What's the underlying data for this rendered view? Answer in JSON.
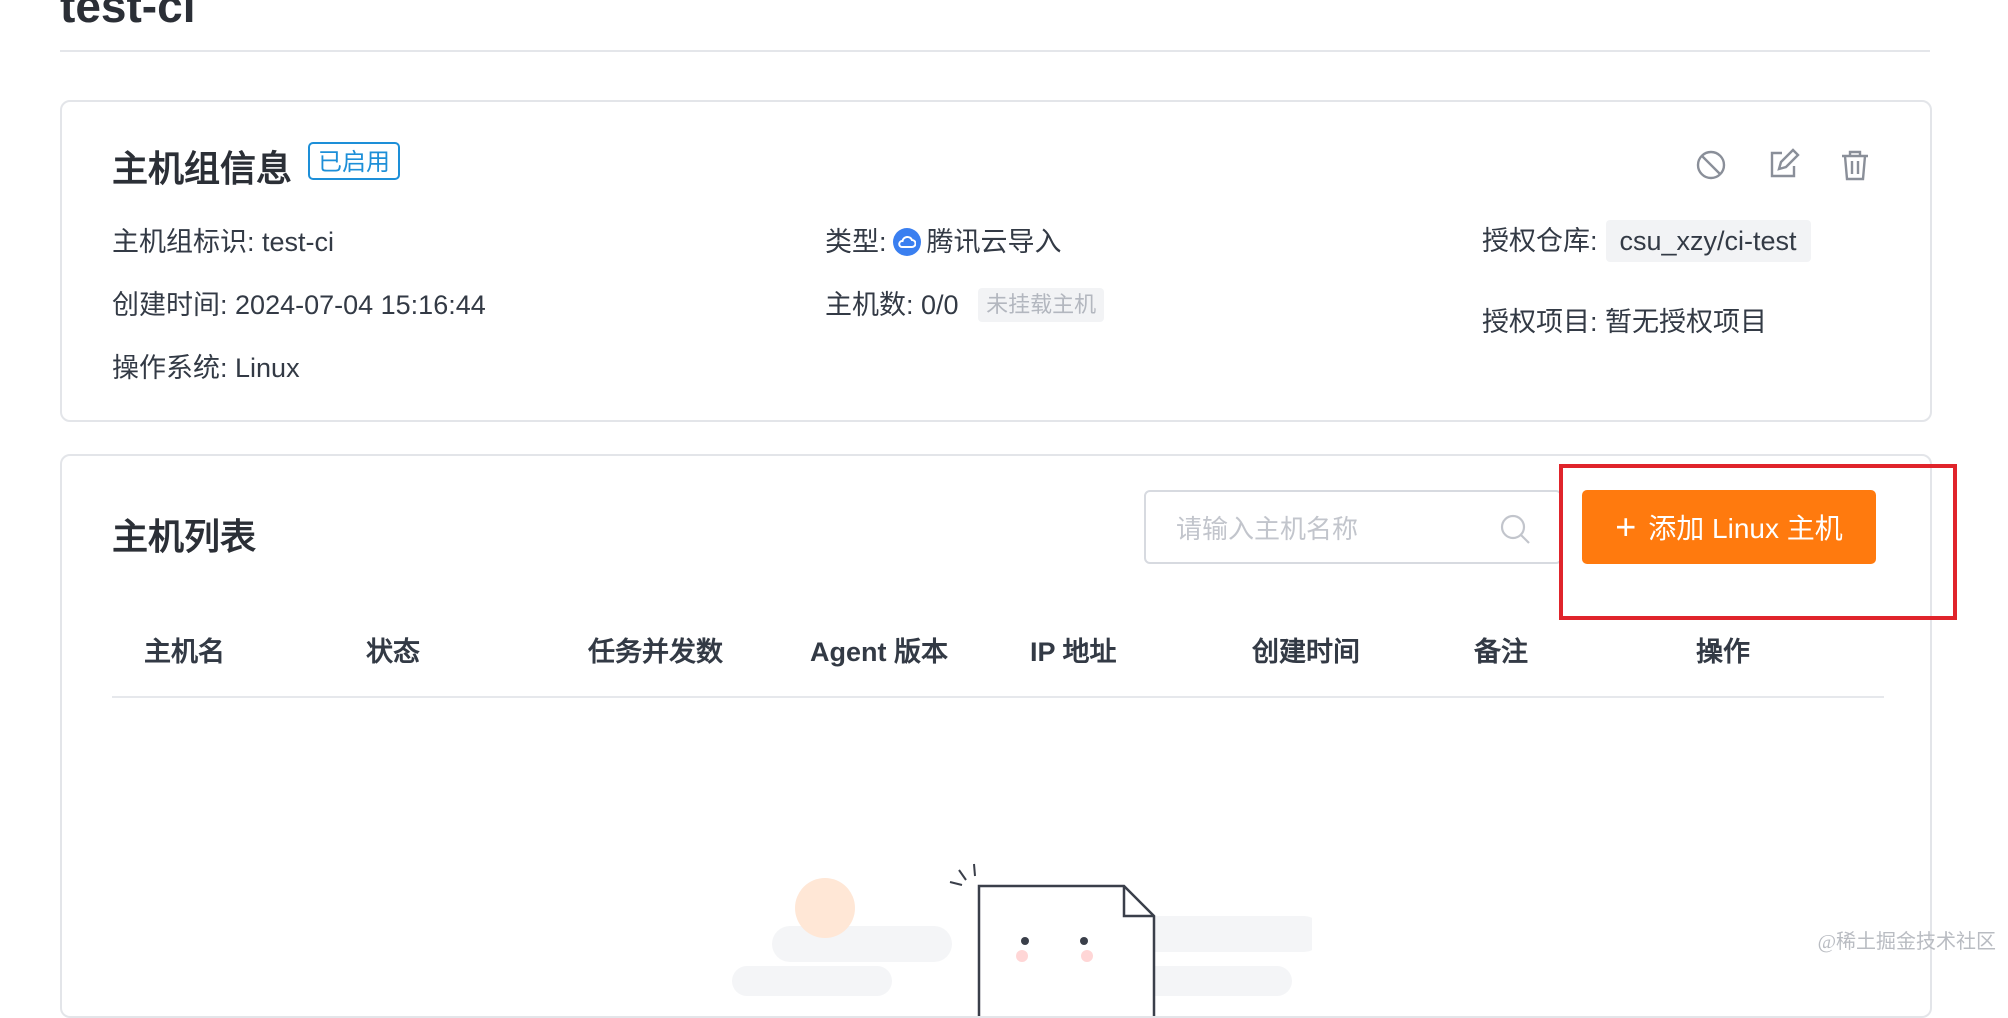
{
  "page": {
    "title": "test-ci"
  },
  "info_card": {
    "title": "主机组信息",
    "status": "已启用",
    "fields": {
      "group_id_label": "主机组标识:",
      "group_id_value": "test-ci",
      "created_label": "创建时间:",
      "created_value": "2024-07-04 15:16:44",
      "os_label": "操作系统:",
      "os_value": "Linux",
      "type_label": "类型:",
      "type_value": "腾讯云导入",
      "host_count_label": "主机数:",
      "host_count_value": "0/0",
      "host_count_tag": "未挂载主机",
      "repo_label": "授权仓库:",
      "repo_value": "csu_xzy/ci-test",
      "project_label": "授权项目:",
      "project_value": "暂无授权项目"
    },
    "actions": [
      "disable-icon",
      "edit-icon",
      "delete-icon"
    ]
  },
  "host_list": {
    "title": "主机列表",
    "search": {
      "placeholder": "请输入主机名称",
      "value": ""
    },
    "add_button": {
      "label": "添加 Linux 主机",
      "icon": "plus-icon"
    },
    "columns": [
      "主机名",
      "状态",
      "任务并发数",
      "Agent 版本",
      "IP 地址",
      "创建时间",
      "备注",
      "操作"
    ],
    "rows": []
  },
  "watermark": "@稀土掘金技术社区",
  "colors": {
    "accent": "#ff7a0e",
    "badge": "#1d8fd8",
    "highlight": "#e0242b",
    "type_icon": "#3a7ff0"
  }
}
